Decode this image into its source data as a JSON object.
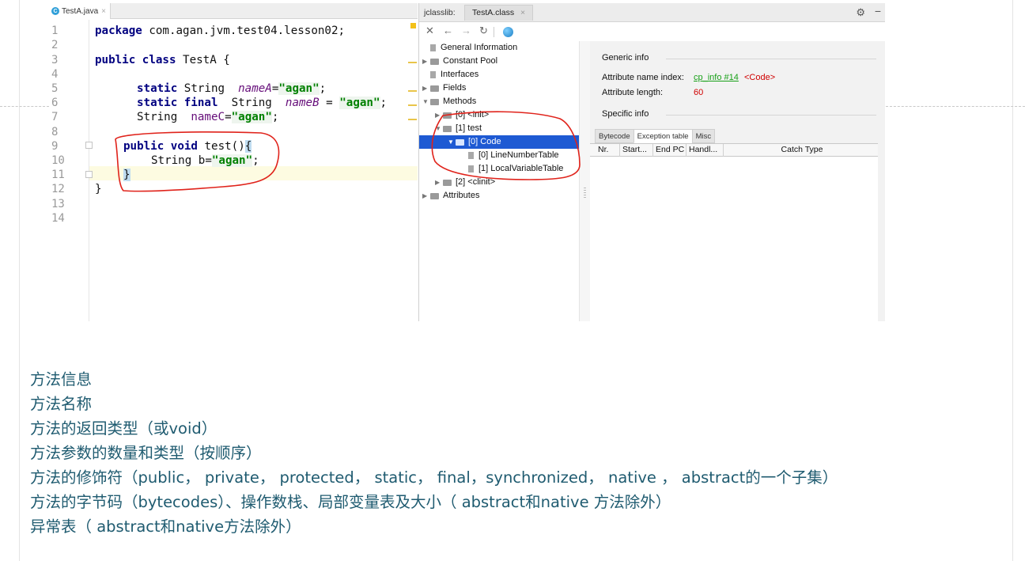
{
  "editor": {
    "tab_label": "TestA.java",
    "tab_icon": "C",
    "close_glyph": "×",
    "line_numbers": [
      "1",
      "2",
      "3",
      "4",
      "5",
      "6",
      "7",
      "8",
      "9",
      "10",
      "11",
      "12",
      "13",
      "14"
    ],
    "code": {
      "l1_kw": "package",
      "l1_rest": " com.agan.jvm.test04.lesson02;",
      "l3_kw": "public class",
      "l3_rest": " TestA {",
      "l5_kw": "static",
      "l5_type": " String  ",
      "l5_name": "nameA",
      "l5_eq": "=",
      "l5_val": "\"agan\"",
      "l5_end": ";",
      "l6_kw": "static final",
      "l6_type": "  String  ",
      "l6_name": "nameB",
      "l6_eq": " = ",
      "l6_val": "\"agan\"",
      "l6_end": ";",
      "l7_type": "String  ",
      "l7_name": "nameC",
      "l7_eq": "=",
      "l7_val": "\"agan\"",
      "l7_end": ";",
      "l9_kw": "public void",
      "l9_rest": " test()",
      "l9_brace": "{",
      "l10_type": "String b=",
      "l10_val": "\"agan\"",
      "l10_end": ";",
      "l11_brace": "}",
      "l12": "}"
    }
  },
  "jclasslib": {
    "title": "jclasslib:",
    "tab_label": "TestA.class",
    "close_glyph": "×",
    "gear_glyph": "⚙",
    "minus_glyph": "−",
    "toolbar": {
      "close": "✕",
      "back": "←",
      "forward": "→",
      "refresh": "↻"
    },
    "tree": [
      {
        "label": "General Information"
      },
      {
        "label": "Constant Pool"
      },
      {
        "label": "Interfaces"
      },
      {
        "label": "Fields"
      },
      {
        "label": "Methods"
      },
      {
        "label": "[0] <init>"
      },
      {
        "label": "[1] test"
      },
      {
        "label": "[0] Code"
      },
      {
        "label": "[0] LineNumberTable"
      },
      {
        "label": "[1] LocalVariableTable"
      },
      {
        "label": "[2] <clinit>"
      },
      {
        "label": "Attributes"
      }
    ],
    "detail": {
      "generic_title": "Generic info",
      "name_index_label": "Attribute name index:",
      "name_index_link": "cp_info #14",
      "name_index_value": "<Code>",
      "length_label": "Attribute length:",
      "length_value": "60",
      "specific_title": "Specific info",
      "subtabs": [
        "Bytecode",
        "Exception table",
        "Misc"
      ],
      "columns": [
        "Nr.",
        "Start...",
        "End PC",
        "Handl...",
        "Catch Type"
      ]
    }
  },
  "colors": {
    "annotation": "#e0231b",
    "note_text": "#1f5b70",
    "tree_selection": "#1e5ad3"
  },
  "notes": [
    "方法信息",
    "方法名称",
    "方法的返回类型（或void）",
    "方法参数的数量和类型（按顺序）",
    "方法的修饰符（public， private， protected， static， final，synchronized， native ， abstract的一个子集）",
    "方法的字节码（bytecodes）、操作数栈、局部变量表及大小（ abstract和native 方法除外）",
    "异常表（ abstract和native方法除外）"
  ]
}
